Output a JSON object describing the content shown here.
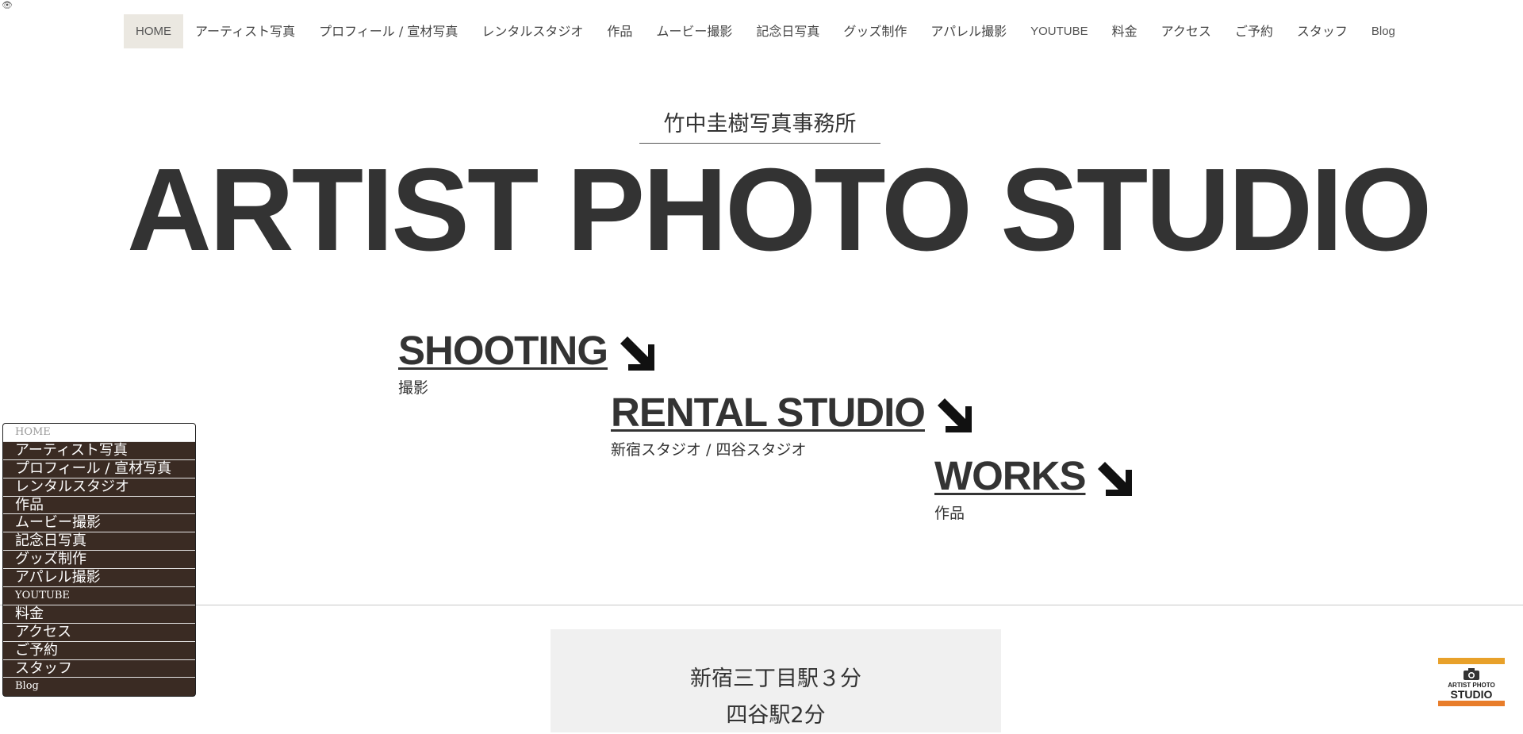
{
  "nav": {
    "items": [
      {
        "label": "HOME"
      },
      {
        "label": "アーティスト写真"
      },
      {
        "label": "プロフィール / 宣材写真"
      },
      {
        "label": "レンタルスタジオ"
      },
      {
        "label": "作品"
      },
      {
        "label": "ムービー撮影"
      },
      {
        "label": "記念日写真"
      },
      {
        "label": "グッズ制作"
      },
      {
        "label": "アパレル撮影"
      },
      {
        "label": "YOUTUBE"
      },
      {
        "label": "料金"
      },
      {
        "label": "アクセス"
      },
      {
        "label": "ご予約"
      },
      {
        "label": "スタッフ"
      },
      {
        "label": "Blog"
      }
    ],
    "active_index": 0
  },
  "header": {
    "office_name": "竹中圭樹写真事務所",
    "title": "ARTIST PHOTO STUDIO"
  },
  "sections": [
    {
      "title": "SHOOTING",
      "subtitle": "撮影",
      "icon": "arrow-down-right-icon"
    },
    {
      "title": "RENTAL STUDIO",
      "subtitle": "新宿スタジオ /  四谷スタジオ",
      "icon": "arrow-down-right-icon"
    },
    {
      "title": "WORKS",
      "subtitle": "作品",
      "icon": "arrow-down-right-icon"
    }
  ],
  "info": {
    "line1": "新宿三丁目駅３分",
    "line2": "四谷駅2分"
  },
  "float_menu": {
    "items": [
      {
        "label": "HOME"
      },
      {
        "label": "アーティスト写真"
      },
      {
        "label": "プロフィール / 宣材写真"
      },
      {
        "label": "レンタルスタジオ"
      },
      {
        "label": "作品"
      },
      {
        "label": "ムービー撮影"
      },
      {
        "label": "記念日写真"
      },
      {
        "label": "グッズ制作"
      },
      {
        "label": "アパレル撮影"
      },
      {
        "label": "YOUTUBE"
      },
      {
        "label": "料金"
      },
      {
        "label": "アクセス"
      },
      {
        "label": "ご予約"
      },
      {
        "label": "スタッフ"
      },
      {
        "label": "Blog"
      }
    ]
  },
  "logo": {
    "line1": "ARTIST PHOTO",
    "line2": "STUDIO"
  },
  "colors": {
    "text": "#333333",
    "nav_active_bg": "#ebe8e1",
    "menu_bg": "#3a2b23",
    "info_bg": "#f0f0f0",
    "logo_orange": "#e8a12a"
  }
}
